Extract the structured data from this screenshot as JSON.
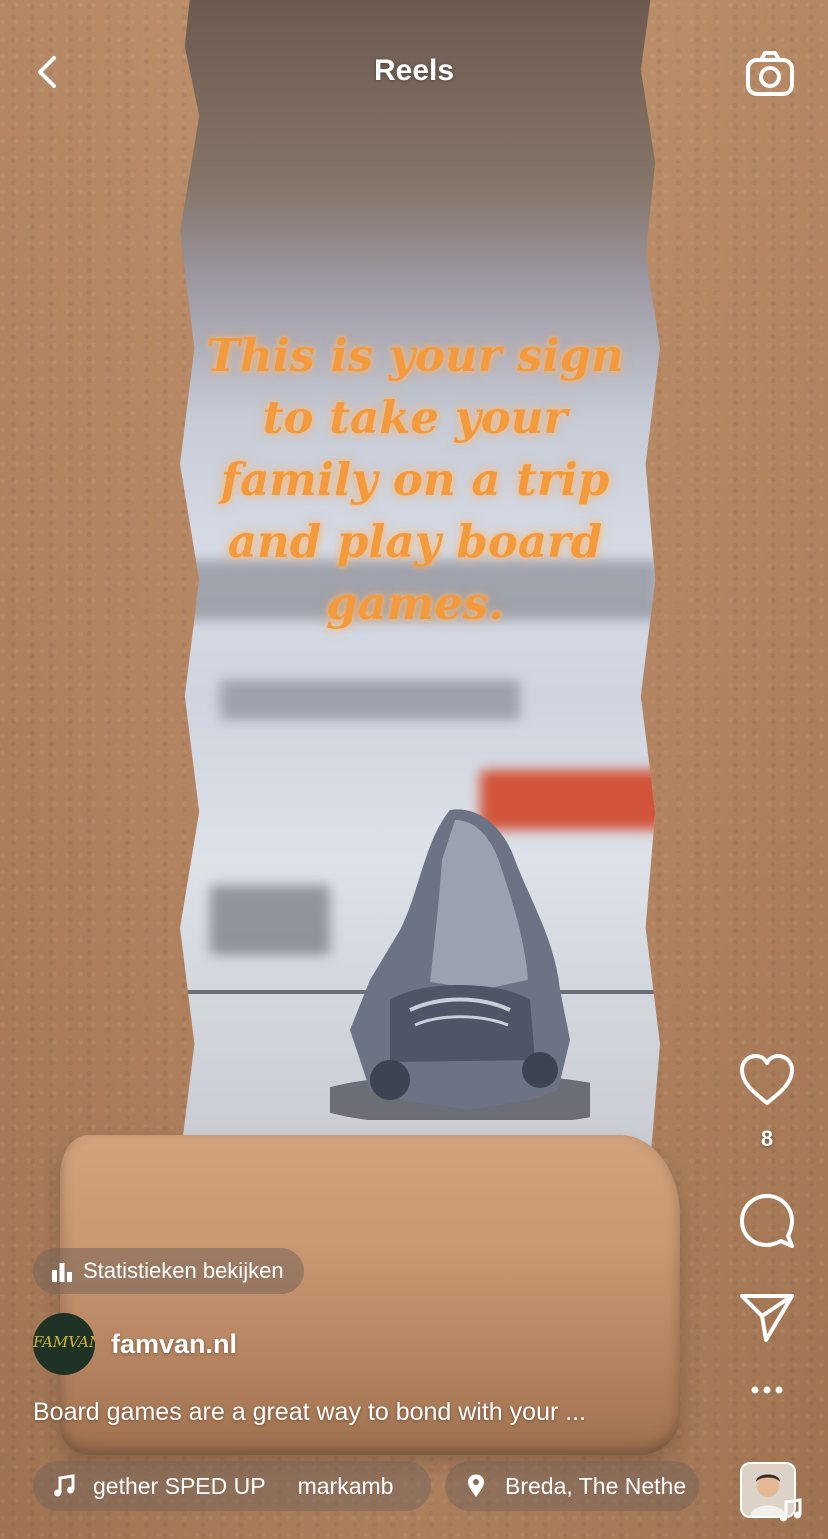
{
  "header": {
    "title": "Reels"
  },
  "video": {
    "overlay_lines": [
      "This is your sign",
      "to take your",
      "family on a trip",
      "and play board",
      "games."
    ]
  },
  "actions": {
    "like_count": "8"
  },
  "stats_button": {
    "label": "Statistieken bekijken"
  },
  "author": {
    "avatar_text": "FAMVAN",
    "name": "famvan.nl"
  },
  "caption": "Board games are a great way to bond with your ...",
  "audio": {
    "track_title": "gether SPED UP",
    "artist": "markamb"
  },
  "location": {
    "label": "Breda, The Nethe"
  },
  "colors": {
    "overlay_text": "#f39a3c",
    "paper": "#b8865e"
  },
  "icons": [
    "chevron-left-icon",
    "camera-icon",
    "heart-icon",
    "comment-icon",
    "send-icon",
    "more-icon",
    "bar-chart-icon",
    "music-note-icon",
    "location-pin-icon"
  ]
}
